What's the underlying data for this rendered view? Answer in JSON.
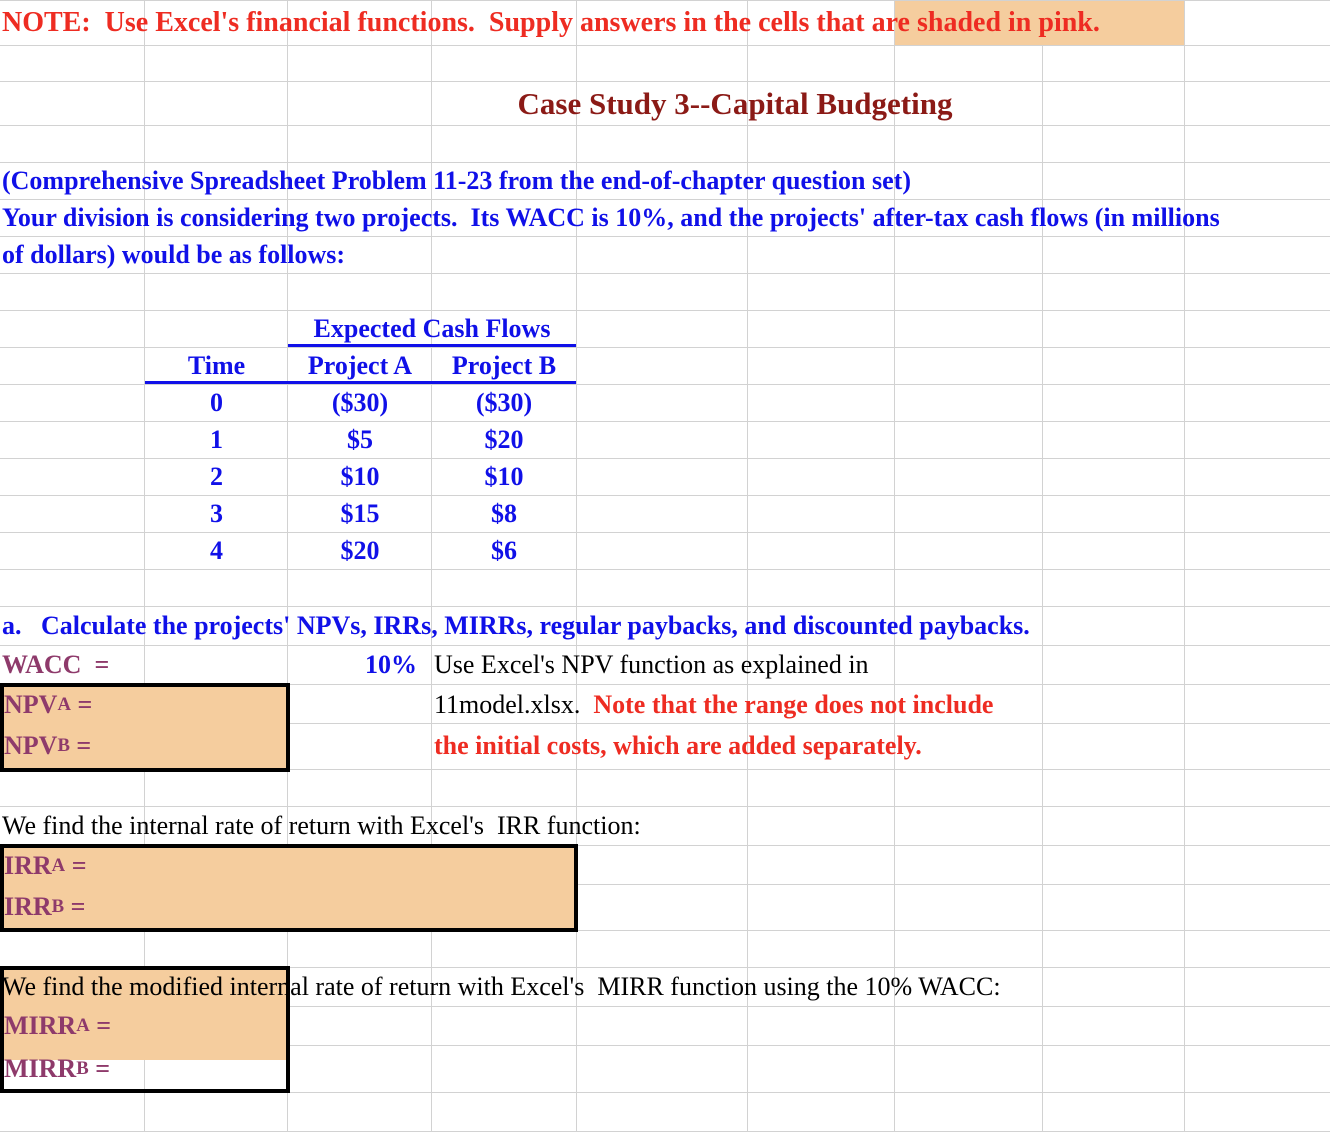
{
  "note": {
    "prefix": "NOTE:  Use Excel's financial functions.  Supply answers in the cells that are ",
    "highlight": "shaded in pink."
  },
  "title": "Case Study 3--Capital Budgeting",
  "intro": {
    "line1": "(Comprehensive Spreadsheet Problem 11-23 from the end-of-chapter question set)",
    "line2": "Your division is considering two projects.  Its WACC is 10%, and the projects' after-tax cash flows (in millions",
    "line3": "of dollars) would be as follows:"
  },
  "cash_flow_table": {
    "group_header": "Expected Cash Flows",
    "headers": [
      "Time",
      "Project A",
      "Project B"
    ],
    "rows": [
      {
        "time": "0",
        "a": "($30)",
        "b": "($30)"
      },
      {
        "time": "1",
        "a": "$5",
        "b": "$20"
      },
      {
        "time": "2",
        "a": "$10",
        "b": "$10"
      },
      {
        "time": "3",
        "a": "$15",
        "b": "$8"
      },
      {
        "time": "4",
        "a": "$20",
        "b": "$6"
      }
    ]
  },
  "question_a": "a.   Calculate the projects' NPVs, IRRs, MIRRs, regular paybacks, and discounted paybacks.",
  "wacc": {
    "label": "WACC  =",
    "value": "10%"
  },
  "npv": {
    "label_a_base": "NPV",
    "label_a_sub": "A",
    "label_a_eq": " =",
    "label_b_base": "NPV",
    "label_b_sub": "B",
    "label_b_eq": " =",
    "value_a": "",
    "value_b": ""
  },
  "npv_instructions": {
    "line1": "Use Excel's NPV function as explained in",
    "line2_black": "11model.xlsx.  ",
    "line2_red": "Note that the range does not include",
    "line3_red": "the initial costs, which are added separately."
  },
  "irr": {
    "heading": "We find the internal rate of return with Excel's  IRR function:",
    "label_a_base": "IRR",
    "label_a_sub": "A",
    "label_a_eq": " =",
    "label_b_base": "IRR",
    "label_b_sub": "B",
    "label_b_eq": " =",
    "value_a": "",
    "value_b": ""
  },
  "mirr": {
    "heading": "We find the modified internal rate of return with Excel's  MIRR function using the 10% WACC:",
    "label_a_base": "MIRR",
    "label_a_sub": "A",
    "label_a_eq": " =",
    "label_b_base": "MIRR",
    "label_b_sub": "B",
    "label_b_eq": " =",
    "value_a": "",
    "value_b": ""
  },
  "colors": {
    "pink_fill": "#F5CD9E",
    "red_text": "#EE2C22",
    "blue_text": "#1010E8",
    "dark_red_text": "#8B1A16",
    "purple_text": "#8E3A6B",
    "gridline": "#D2D2D2"
  }
}
